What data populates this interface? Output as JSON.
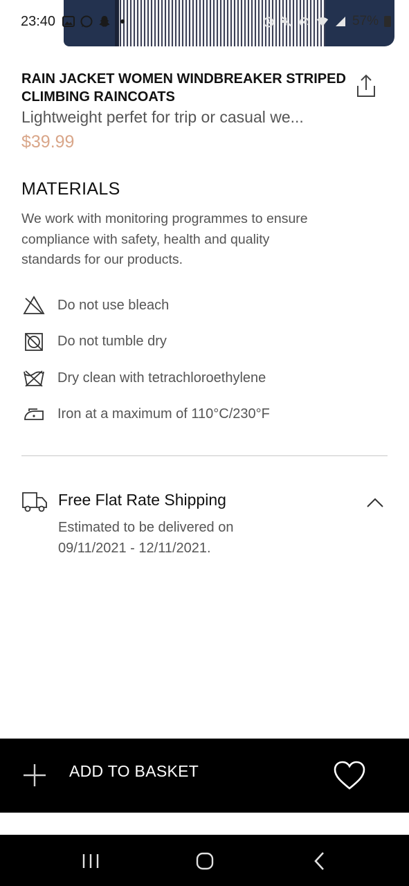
{
  "status_bar": {
    "time": "23:40",
    "battery": "57%",
    "left_icons": [
      "gallery-icon",
      "whatsapp-icon",
      "snapchat-icon",
      "dot-icon"
    ],
    "right_icons": [
      "alarm-icon",
      "mute-icon",
      "hotspot-icon",
      "wifi-icon",
      "signal-icon",
      "battery-icon"
    ]
  },
  "product": {
    "title": "RAIN JACKET WOMEN WINDBREAKER STRIPED CLIMBING RAINCOATS",
    "subtitle": "Lightweight perfet for trip or casual we...",
    "price": "$39.99",
    "price_color": "#d9a689"
  },
  "materials": {
    "heading": "MATERIALS",
    "text": "We work with monitoring programmes to ensure compliance with safety, health and quality standards for our products.",
    "care": [
      {
        "icon": "no-bleach-icon",
        "label": "Do not use bleach"
      },
      {
        "icon": "no-tumble-dry-icon",
        "label": "Do not tumble dry"
      },
      {
        "icon": "dry-clean-icon",
        "label": "Dry clean with tetrachloroethylene"
      },
      {
        "icon": "iron-icon",
        "label": "Iron at a maximum of 110°C/230°F"
      }
    ]
  },
  "shipping": {
    "title": "Free Flat Rate Shipping",
    "text": "Estimated to be delivered on 09/11/2021 - 12/11/2021.",
    "expanded": true
  },
  "basket_bar": {
    "label": "ADD TO BASKET",
    "background": "#000000"
  }
}
